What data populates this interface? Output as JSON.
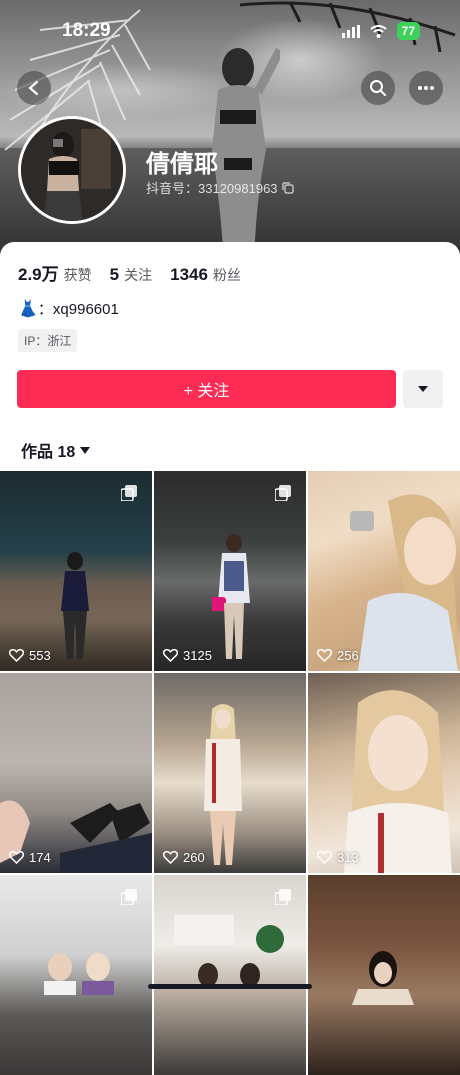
{
  "status_bar": {
    "time": "18:29",
    "battery": "77",
    "icons": [
      "signal-icon",
      "wifi-icon",
      "battery-icon"
    ]
  },
  "header": {
    "back_icon": "chevron-left-icon",
    "search_icon": "search-icon",
    "more_icon": "ellipsis-icon"
  },
  "profile": {
    "nickname": "倩倩耶",
    "douyin_id": "抖音号：33120981963",
    "copy_icon": "copy-icon"
  },
  "stats": [
    {
      "value": "2.9万",
      "label": "获赞"
    },
    {
      "value": "5",
      "label": "关注"
    },
    {
      "value": "1346",
      "label": "粉丝"
    }
  ],
  "signature": {
    "emoji": "👗",
    "text": "：xq996601"
  },
  "ip": "IP：浙江",
  "actions": {
    "follow_label": "+ 关注",
    "dropdown_icon": "caret-down-icon"
  },
  "works_tab": {
    "label": "作品 18",
    "dropdown_icon": "caret-down-icon"
  },
  "videos": [
    {
      "likes": "553",
      "multi_image": true
    },
    {
      "likes": "3125",
      "multi_image": true
    },
    {
      "likes": "256",
      "multi_image": false
    },
    {
      "likes": "174",
      "multi_image": false
    },
    {
      "likes": "260",
      "multi_image": false
    },
    {
      "likes": "313",
      "multi_image": false
    },
    {
      "likes": "",
      "multi_image": true
    },
    {
      "likes": "",
      "multi_image": true
    },
    {
      "likes": "",
      "multi_image": false
    }
  ],
  "colors": {
    "accent": "#fe2c55",
    "text_primary": "#161823",
    "text_secondary": "#57595f",
    "chip_bg": "#f1f1f2"
  }
}
